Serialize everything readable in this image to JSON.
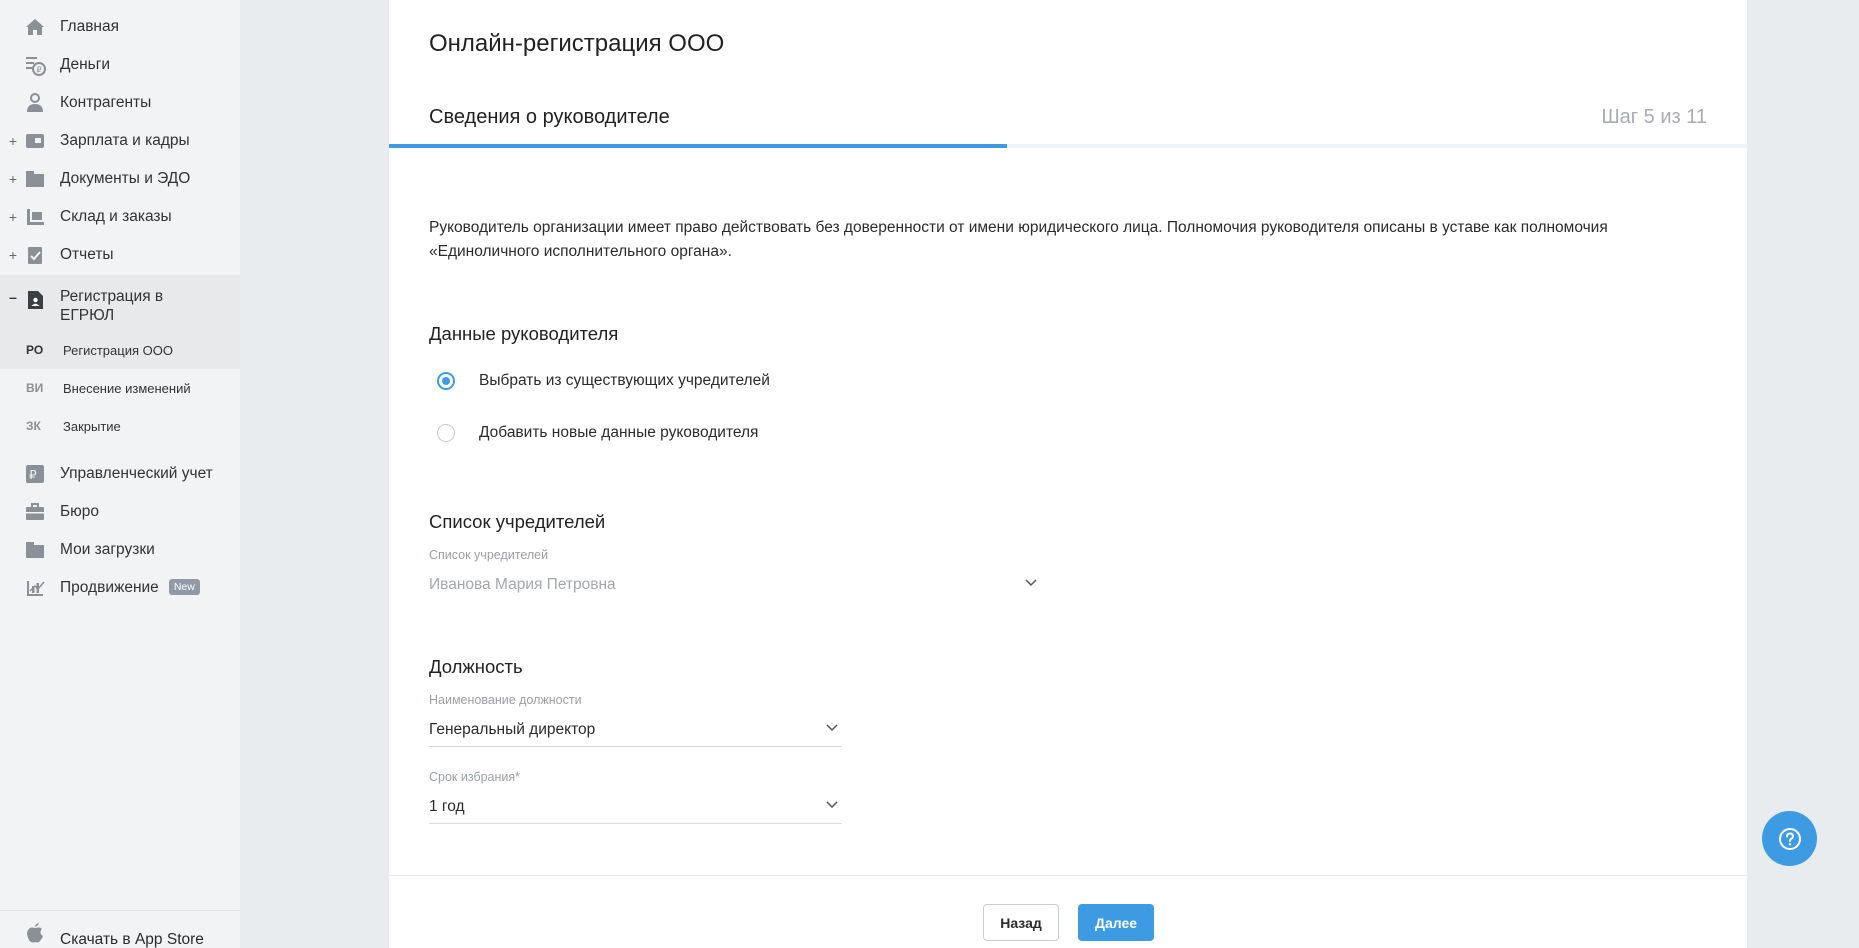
{
  "sidebar": {
    "items": [
      {
        "label": "Главная",
        "icon": "home-icon"
      },
      {
        "label": "Деньги",
        "icon": "money-icon"
      },
      {
        "label": "Контрагенты",
        "icon": "contractors-icon"
      },
      {
        "label": "Зарплата и кадры",
        "icon": "salary-icon",
        "expand": "+"
      },
      {
        "label": "Документы и ЭДО",
        "icon": "documents-icon",
        "expand": "+"
      },
      {
        "label": "Склад и заказы",
        "icon": "warehouse-icon",
        "expand": "+"
      },
      {
        "label": "Отчеты",
        "icon": "reports-icon",
        "expand": "+"
      },
      {
        "label": "Регистрация в ЕГРЮЛ",
        "icon": "registration-icon",
        "expand": "–"
      }
    ],
    "sub_items": [
      {
        "abbr": "РО",
        "label": "Регистрация ООО"
      },
      {
        "abbr": "ВИ",
        "label": "Внесение изменений"
      },
      {
        "abbr": "ЗК",
        "label": "Закрытие"
      }
    ],
    "items2": [
      {
        "label": "Управленческий учет",
        "icon": "management-icon"
      },
      {
        "label": "Бюро",
        "icon": "bureau-icon"
      },
      {
        "label": "Мои загрузки",
        "icon": "folder-icon"
      },
      {
        "label": "Продвижение",
        "icon": "promotion-icon",
        "badge": "New"
      }
    ],
    "bottom": {
      "label": "Скачать в App Store",
      "icon": "apple-icon"
    }
  },
  "main": {
    "page_title": "Онлайн-регистрация ООО",
    "step_title": "Сведения о руководителе",
    "step_counter": "Шаг 5 из 11",
    "progress": 0.455,
    "description": "Руководитель организации имеет право действовать без доверенности от имени юридического лица. Полномочия руководителя описаны в уставе как полномочия «Единоличного исполнительного органа».",
    "director_data": {
      "heading": "Данные руководителя",
      "options": [
        {
          "label": "Выбрать из существующих учредителей",
          "checked": true
        },
        {
          "label": "Добавить новые данные руководителя",
          "checked": false
        }
      ]
    },
    "founders": {
      "heading": "Список учредителей",
      "field_label": "Список учредителей",
      "value": "Иванова Мария Петровна"
    },
    "position": {
      "heading": "Должность",
      "title_label": "Наименование должности",
      "title_value": "Генеральный директор",
      "term_label": "Срок избрания*",
      "term_value": "1 год"
    },
    "buttons": {
      "back": "Назад",
      "next": "Далее"
    }
  },
  "colors": {
    "accent": "#3d9be3",
    "sidebar_bg": "#f2f3f4",
    "page_bg": "#e9ecef"
  }
}
